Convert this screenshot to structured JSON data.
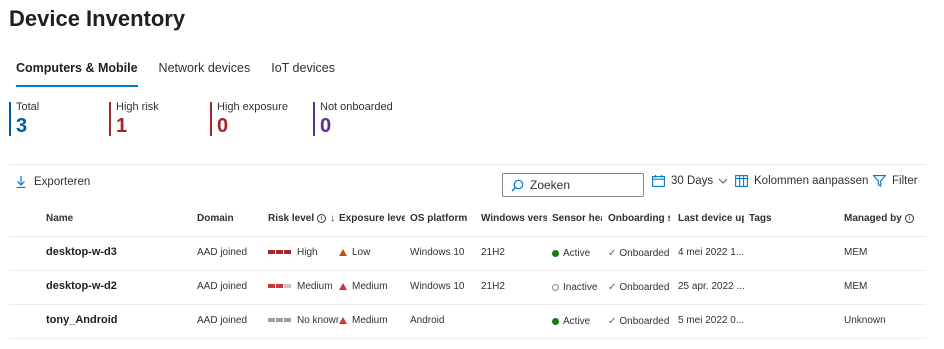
{
  "page": {
    "title": "Device Inventory"
  },
  "tabs": [
    {
      "label": "Computers & Mobile",
      "active": true
    },
    {
      "label": "Network devices",
      "active": false
    },
    {
      "label": "IoT devices",
      "active": false
    }
  ],
  "stats": [
    {
      "label": "Total",
      "value": "3",
      "color": "#005a9e"
    },
    {
      "label": "High risk",
      "value": "1",
      "color": "#a4262c"
    },
    {
      "label": "High exposure",
      "value": "0",
      "color": "#a4262c"
    },
    {
      "label": "Not onboarded",
      "value": "0",
      "color": "#5c2e91"
    }
  ],
  "toolbar": {
    "export_label": "Exporteren",
    "search_placeholder": "Zoeken",
    "range_label": "30 Days",
    "columns_label": "Kolommen aanpassen",
    "filter_label": "Filter"
  },
  "columns": {
    "name": "Name",
    "domain": "Domain",
    "risk": "Risk level",
    "exposure": "Exposure level",
    "os": "OS platform",
    "winver": "Windows version",
    "sensor": "Sensor health state",
    "onboarding": "Onboarding status",
    "lastupdate": "Last device update",
    "tags": "Tags",
    "managed": "Managed by"
  },
  "rows": [
    {
      "name": "desktop-w-d3",
      "domain": "AAD joined",
      "risk": "High",
      "risk_level": 3,
      "exposure": "Low",
      "exposure_color": "#ca5010",
      "os": "Windows 10",
      "winver": "21H2",
      "sensor": "Active",
      "sensor_active": true,
      "onboarding": "Onboarded",
      "lastupdate": "4 mei 2022 1...",
      "tags": "",
      "managed": "MEM"
    },
    {
      "name": "desktop-w-d2",
      "domain": "AAD joined",
      "risk": "Medium",
      "risk_level": 2,
      "exposure": "Medium",
      "exposure_color": "#d13438",
      "os": "Windows 10",
      "winver": "21H2",
      "sensor": "Inactive",
      "sensor_active": false,
      "onboarding": "Onboarded",
      "lastupdate": "25 apr. 2022 ...",
      "tags": "",
      "managed": "MEM"
    },
    {
      "name": "tony_Android",
      "domain": "AAD joined",
      "risk": "No known",
      "risk_level": 0,
      "exposure": "Medium",
      "exposure_color": "#d13438",
      "os": "Android",
      "winver": "",
      "sensor": "Active",
      "sensor_active": true,
      "onboarding": "Onboarded",
      "lastupdate": "5 mei 2022 0...",
      "tags": "",
      "managed": "Unknown"
    }
  ]
}
